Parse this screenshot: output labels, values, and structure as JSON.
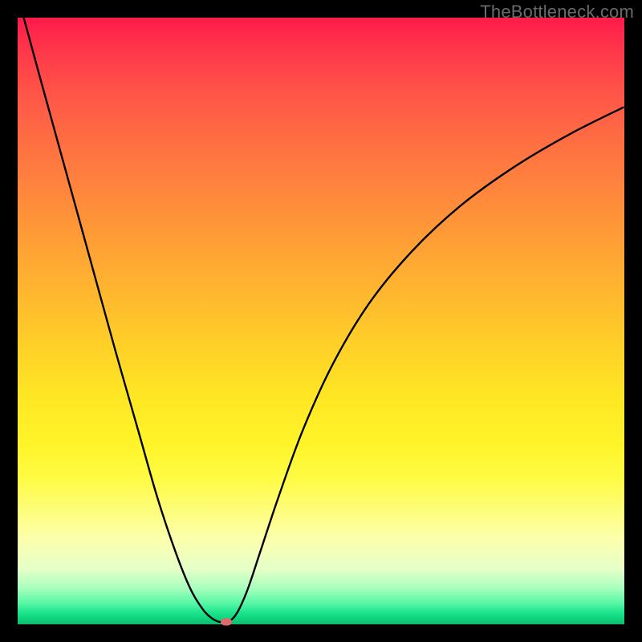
{
  "watermark": "TheBottleneck.com",
  "chart_data": {
    "type": "line",
    "title": "",
    "xlabel": "",
    "ylabel": "",
    "xlim": [
      0,
      1
    ],
    "ylim": [
      0,
      1
    ],
    "grid": false,
    "legend": false,
    "series": [
      {
        "name": "curve",
        "color": "#000000",
        "x": [
          0.01,
          0.04,
          0.08,
          0.12,
          0.16,
          0.2,
          0.23,
          0.26,
          0.285,
          0.305,
          0.32,
          0.333,
          0.345,
          0.355,
          0.365,
          0.38,
          0.4,
          0.43,
          0.47,
          0.52,
          0.58,
          0.65,
          0.73,
          0.82,
          0.91,
          0.998
        ],
        "y": [
          1.0,
          0.89,
          0.745,
          0.6,
          0.455,
          0.315,
          0.21,
          0.12,
          0.058,
          0.025,
          0.01,
          0.004,
          0.004,
          0.01,
          0.025,
          0.06,
          0.12,
          0.21,
          0.32,
          0.43,
          0.53,
          0.615,
          0.69,
          0.755,
          0.808,
          0.852
        ]
      }
    ],
    "annotations": [
      {
        "name": "marker",
        "x": 0.344,
        "y": 0.004,
        "shape": "oval",
        "color": "#e06868"
      }
    ],
    "background_gradient": {
      "type": "vertical",
      "stops": [
        {
          "pos": 0.0,
          "color": "#ff1a4b"
        },
        {
          "pos": 0.5,
          "color": "#ffd028"
        },
        {
          "pos": 0.86,
          "color": "#fcffad"
        },
        {
          "pos": 1.0,
          "color": "#0fba6b"
        }
      ]
    }
  }
}
